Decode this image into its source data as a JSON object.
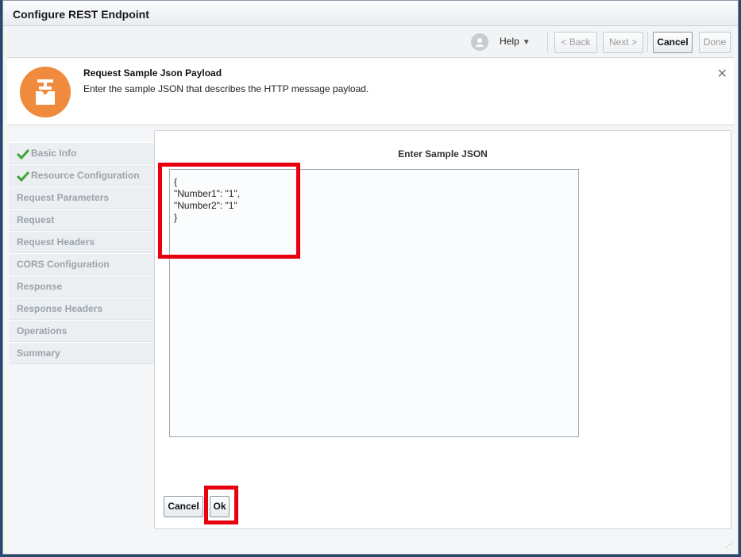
{
  "window": {
    "title": "Configure REST Endpoint"
  },
  "toolbar": {
    "help_label": "Help",
    "back_label": "< Back",
    "next_label": "Next >",
    "cancel_label": "Cancel",
    "done_label": "Done"
  },
  "header": {
    "title": "Request Sample Json Payload",
    "description": "Enter the sample JSON that describes the HTTP message payload."
  },
  "nav": {
    "items": [
      {
        "label": "Basic Info",
        "done": true
      },
      {
        "label": "Resource Configuration",
        "done": true
      },
      {
        "label": "Request Parameters",
        "done": false
      },
      {
        "label": "Request",
        "done": false
      },
      {
        "label": "Request Headers",
        "done": false
      },
      {
        "label": "CORS Configuration",
        "done": false
      },
      {
        "label": "Response",
        "done": false
      },
      {
        "label": "Response Headers",
        "done": false
      },
      {
        "label": "Operations",
        "done": false
      },
      {
        "label": "Summary",
        "done": false
      }
    ]
  },
  "content": {
    "title": "Enter Sample JSON",
    "json_value": "{\n\"Number1\": \"1\",\n\"Number2\": \"1\"\n}",
    "cancel_label": "Cancel",
    "ok_label": "Ok"
  },
  "colors": {
    "highlight": "#e8000f",
    "header_icon_bg": "#f08a3c",
    "check_green": "#3aa53a"
  }
}
